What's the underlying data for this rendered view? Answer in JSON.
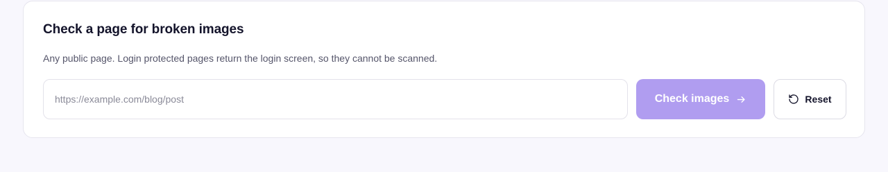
{
  "card": {
    "title": "Check a page for broken images",
    "subtitle": "Any public page. Login protected pages return the login screen, so they cannot be scanned."
  },
  "form": {
    "url_value": "",
    "url_placeholder": "https://example.com/blog/post",
    "check_label": "Check images",
    "check_icon": "arrow-right-icon",
    "reset_label": "Reset",
    "reset_icon": "rotate-ccw-icon"
  },
  "colors": {
    "page_background": "#f8f7fd",
    "primary_button": "#b09df0",
    "title_text": "#14142b",
    "muted_text": "#55556a"
  }
}
